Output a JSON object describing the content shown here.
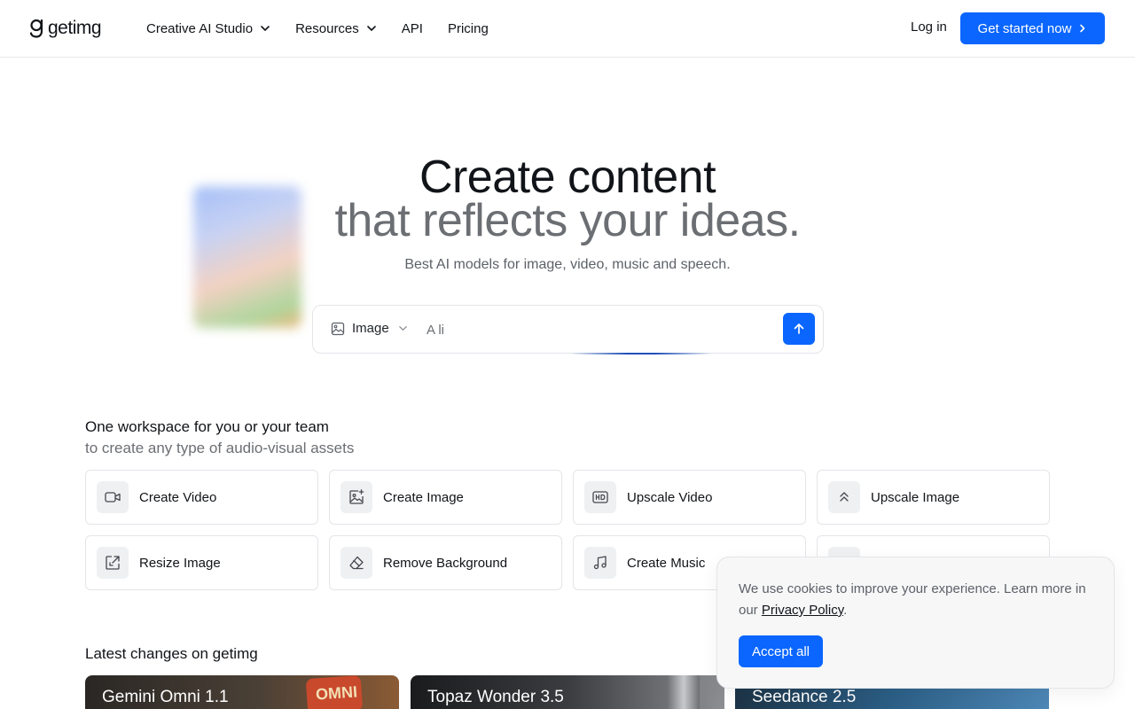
{
  "header": {
    "logo_text": "getimg",
    "nav": [
      {
        "label": "Creative AI Studio",
        "has_dropdown": true
      },
      {
        "label": "Resources",
        "has_dropdown": true
      },
      {
        "label": "API",
        "has_dropdown": false
      },
      {
        "label": "Pricing",
        "has_dropdown": false
      }
    ],
    "login_label": "Log in",
    "cta_label": "Get started now"
  },
  "hero": {
    "title_line1": "Create content",
    "title_line2": "that reflects your ideas.",
    "subtitle": "Best AI models for image, video, music and speech."
  },
  "prompt": {
    "mode_label": "Image",
    "mode_icon": "image-icon",
    "input_value": "A li",
    "submit_icon": "arrow-up-icon"
  },
  "workspace": {
    "title": "One workspace for you or your team",
    "subtitle": "to create any type of audio-visual assets",
    "tools": [
      {
        "label": "Create Video",
        "icon": "video-camera-icon"
      },
      {
        "label": "Create Image",
        "icon": "image-sparkle-icon"
      },
      {
        "label": "Upscale Video",
        "icon": "hd-icon"
      },
      {
        "label": "Upscale Image",
        "icon": "chevrons-up-icon"
      },
      {
        "label": "Resize Image",
        "icon": "resize-icon"
      },
      {
        "label": "Remove Background",
        "icon": "eraser-icon"
      },
      {
        "label": "Create Music",
        "icon": "music-note-icon"
      },
      {
        "label": "",
        "icon": "tool-icon"
      }
    ]
  },
  "latest": {
    "title": "Latest changes on getimg",
    "cards": [
      {
        "title": "Gemini Omni 1.1",
        "deco_text": "OMNI"
      },
      {
        "title": "Topaz Wonder 3.5"
      },
      {
        "title": "Seedance 2.5"
      }
    ]
  },
  "cookie": {
    "text_before": "We use cookies to improve your experience. Learn more in our ",
    "link_label": "Privacy Policy",
    "text_after": ".",
    "accept_label": "Accept all"
  },
  "colors": {
    "accent": "#0a66ff",
    "text_primary": "#111418",
    "text_muted": "#6b6e72"
  }
}
